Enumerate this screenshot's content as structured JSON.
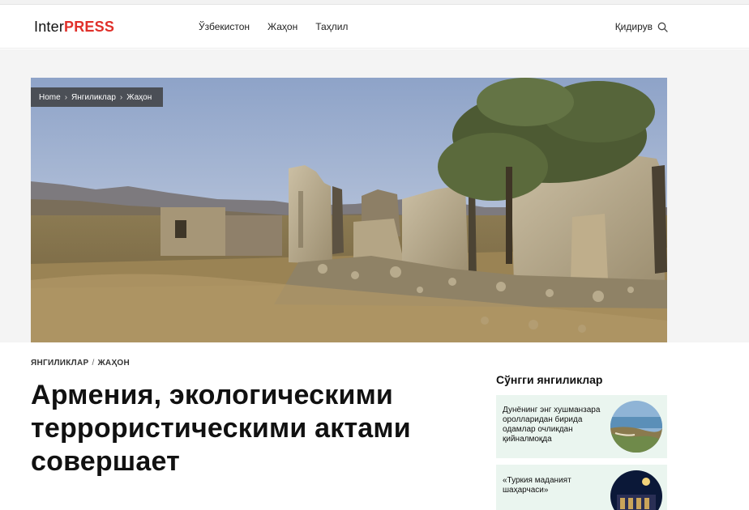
{
  "site": {
    "logo_part1": "Inter",
    "logo_part2": "PRESS",
    "brand_color": "#e0302a"
  },
  "nav": {
    "items": [
      "Ўзбекистон",
      "Жаҳон",
      "Таҳлил"
    ]
  },
  "search": {
    "label": "Қидирув",
    "icon": "search-icon"
  },
  "breadcrumb": {
    "items": [
      "Home",
      "Янгиликлар",
      "Жаҳон"
    ],
    "separator": "›"
  },
  "article": {
    "category_1": "ЯНГИЛИКЛАР",
    "category_sep": "/",
    "category_2": "ЖАҲОН",
    "title": "Армения, экологическими террористическими актами совершает"
  },
  "sidebar": {
    "title": "Сўнгги янгиликлар",
    "items": [
      {
        "text": "Дунёнинг энг хушманзара оролларидан бирида одамлар очликдан қийналмоқда"
      },
      {
        "text": "«Туркия маданият шаҳарчаси»"
      }
    ]
  }
}
